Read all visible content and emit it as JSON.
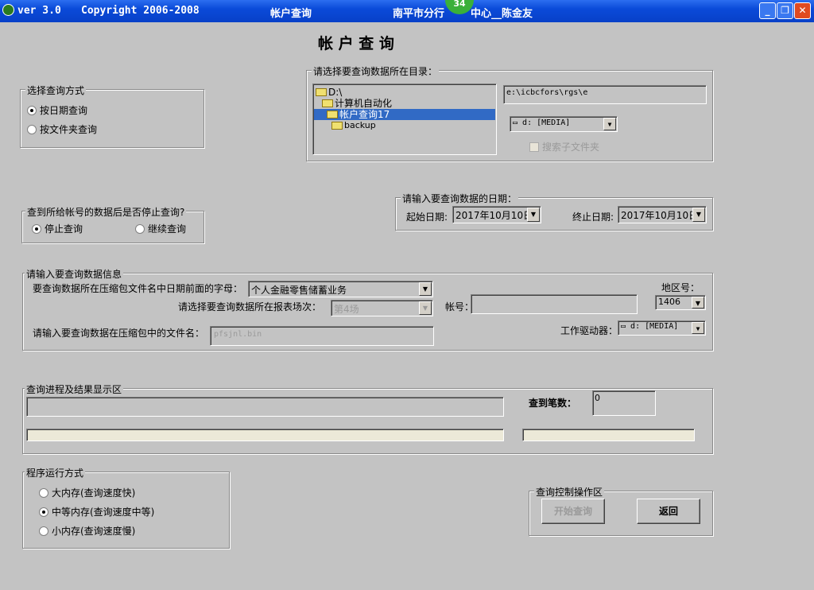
{
  "titlebar": {
    "version": "ver 3.0",
    "copyright": "Copyright 2006-2008",
    "window_title": "帐户查询",
    "org": "南平市分行",
    "org_tail": "中心__陈金友",
    "badge": "34"
  },
  "page_title": "帐 户 查 询",
  "query_method": {
    "legend": "选择查询方式",
    "options": [
      "按日期查询",
      "按文件夹查询"
    ],
    "selected": 0
  },
  "directory": {
    "legend": "请选择要查询数据所在目录：",
    "tree": [
      "D:\\",
      "计算机自动化",
      "帐户查询17",
      "backup"
    ],
    "selected_index": 2,
    "path": "e:\\icbcfors\\rgs\\e",
    "drive": "d: [MEDIA]",
    "subfolder_checkbox": "搜索子文件夹"
  },
  "stop": {
    "legend": "查到所给帐号的数据后是否停止查询?",
    "options": [
      "停止查询",
      "继续查询"
    ],
    "selected": 0
  },
  "dates": {
    "legend": "请输入要查询数据的日期：",
    "start_label": "起始日期:",
    "start": "2017年10月10日",
    "end_label": "终止日期:",
    "end": "2017年10月10日"
  },
  "info": {
    "legend": "请输入要查询数据信息",
    "prefix_label": "要查询数据所在压缩包文件名中日期前面的字母：",
    "prefix_value": "个人金融零售储蓄业务",
    "session_label": "请选择要查询数据所在报表场次：",
    "session_value": "第4场",
    "account_label": "帐号：",
    "account_value": "",
    "region_label": "地区号：",
    "region_value": "1406",
    "filename_label": "请输入要查询数据在压缩包中的文件名：",
    "filename_value": "pfsjnl.bin",
    "drive_label": "工作驱动器：",
    "drive_value": "d: [MEDIA]"
  },
  "progress": {
    "legend": "查询进程及结果显示区",
    "count_label": "查到笔数：",
    "count": "0",
    "progress1": 0,
    "progress2": 0
  },
  "run_mode": {
    "legend": "程序运行方式",
    "options": [
      "大内存(查询速度快)",
      "中等内存(查询速度中等)",
      "小内存(查询速度慢)"
    ],
    "selected": 1
  },
  "control": {
    "legend": "查询控制操作区",
    "start": "开始查询",
    "back": "返回"
  }
}
